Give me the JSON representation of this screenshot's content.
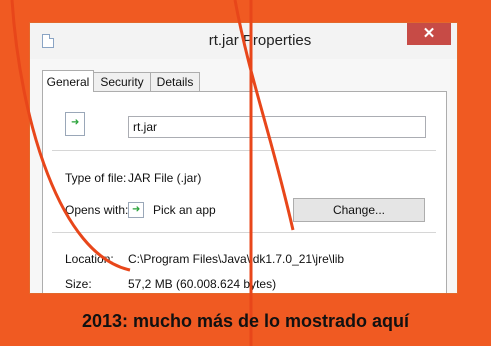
{
  "window": {
    "title": "rt.jar Properties",
    "close_label": "✕"
  },
  "tabs": [
    {
      "label": "General"
    },
    {
      "label": "Security"
    },
    {
      "label": "Details"
    }
  ],
  "general": {
    "file_name": "rt.jar",
    "type_label": "Type of file:",
    "type_value": "JAR File (.jar)",
    "opens_label": "Opens with:",
    "opens_value": "Pick an app",
    "change_button": "Change...",
    "location_label": "Location:",
    "location_value": "C:\\Program Files\\Java\\jdk1.7.0_21\\jre\\lib",
    "size_label": "Size:",
    "size_value": "57,2 MB (60.008.624 bytes)"
  },
  "caption": "2013: mucho más de lo mostrado aquí",
  "colors": {
    "background": "#f05a22",
    "annotation_line": "#e8461a",
    "close_button": "#c74b46"
  },
  "icons": [
    "app-icon",
    "jar-file-icon",
    "pick-app-icon"
  ]
}
